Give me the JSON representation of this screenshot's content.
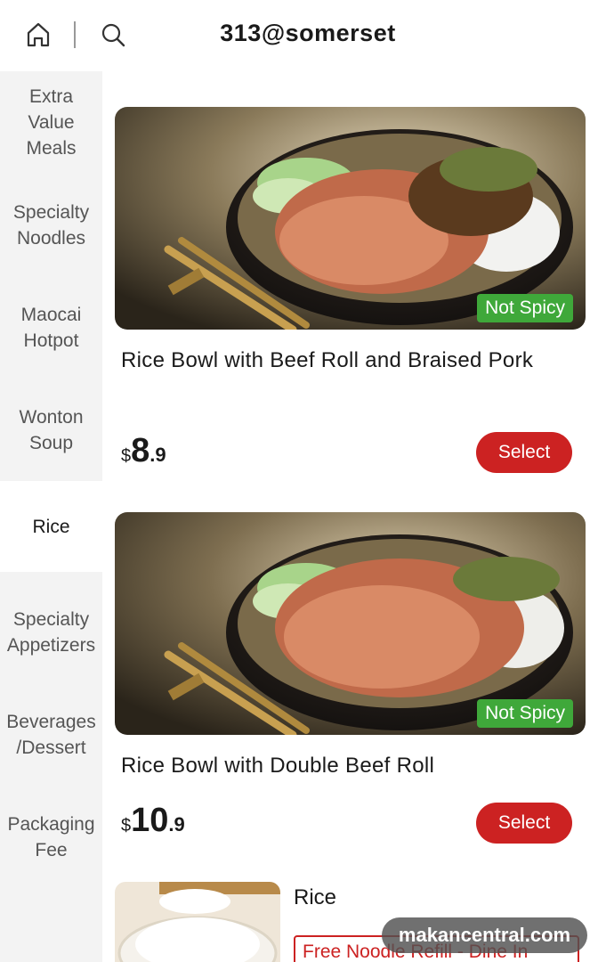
{
  "header": {
    "title": "313@somerset",
    "home_icon": "home-icon",
    "search_icon": "search-icon"
  },
  "sidebar": {
    "items": [
      {
        "label": "Extra\nValue\nMeals",
        "active": false
      },
      {
        "label": "Specialty\nNoodles",
        "active": false
      },
      {
        "label": "Maocai\nHotpot",
        "active": false
      },
      {
        "label": "Wonton\nSoup",
        "active": false
      },
      {
        "label": "Rice",
        "active": true
      },
      {
        "label": "Specialty\nAppetizers",
        "active": false
      },
      {
        "label": "Beverages\n/Dessert",
        "active": false
      },
      {
        "label": "Packaging\nFee",
        "active": false
      }
    ]
  },
  "products": [
    {
      "name": "Rice Bowl with Beef Roll and Braised Pork",
      "badge": "Not Spicy",
      "currency": "$",
      "price_int": "8",
      "price_dec": ".9",
      "button": "Select"
    },
    {
      "name": "Rice Bowl with Double Beef Roll",
      "badge": "Not Spicy",
      "currency": "$",
      "price_int": "10",
      "price_dec": ".9",
      "button": "Select"
    }
  ],
  "partial_product": {
    "name": "Rice",
    "promo": "Free Noodle Refill - Dine In"
  },
  "watermark": "makancentral.com",
  "colors": {
    "accent_red": "#cc2222",
    "badge_green": "#3fa83a",
    "sidebar_bg": "#f3f3f3"
  }
}
